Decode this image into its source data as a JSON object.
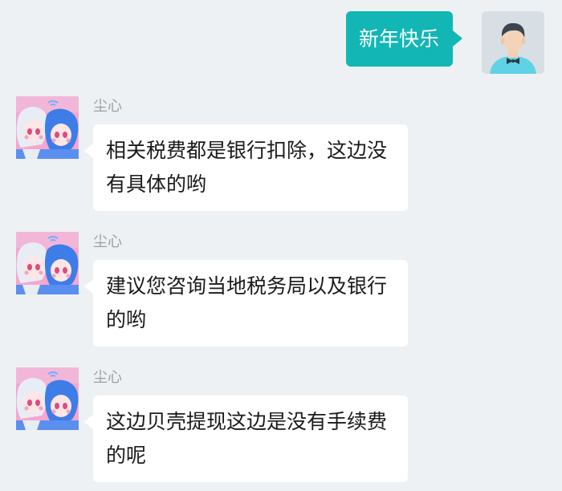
{
  "chat": {
    "outgoing": {
      "text": "新年快乐"
    },
    "messages": [
      {
        "sender": "尘心",
        "text": "相关税费都是银行扣除，这边没有具体的哟"
      },
      {
        "sender": "尘心",
        "text": "建议您咨询当地税务局以及银行的哟"
      },
      {
        "sender": "尘心",
        "text": "这边贝壳提现这边是没有手续费的呢"
      }
    ]
  },
  "colors": {
    "background": "#eef1f3",
    "outgoing_bubble": "#12b7b5",
    "incoming_bubble": "#ffffff",
    "sender_name": "#9aa0a6"
  }
}
